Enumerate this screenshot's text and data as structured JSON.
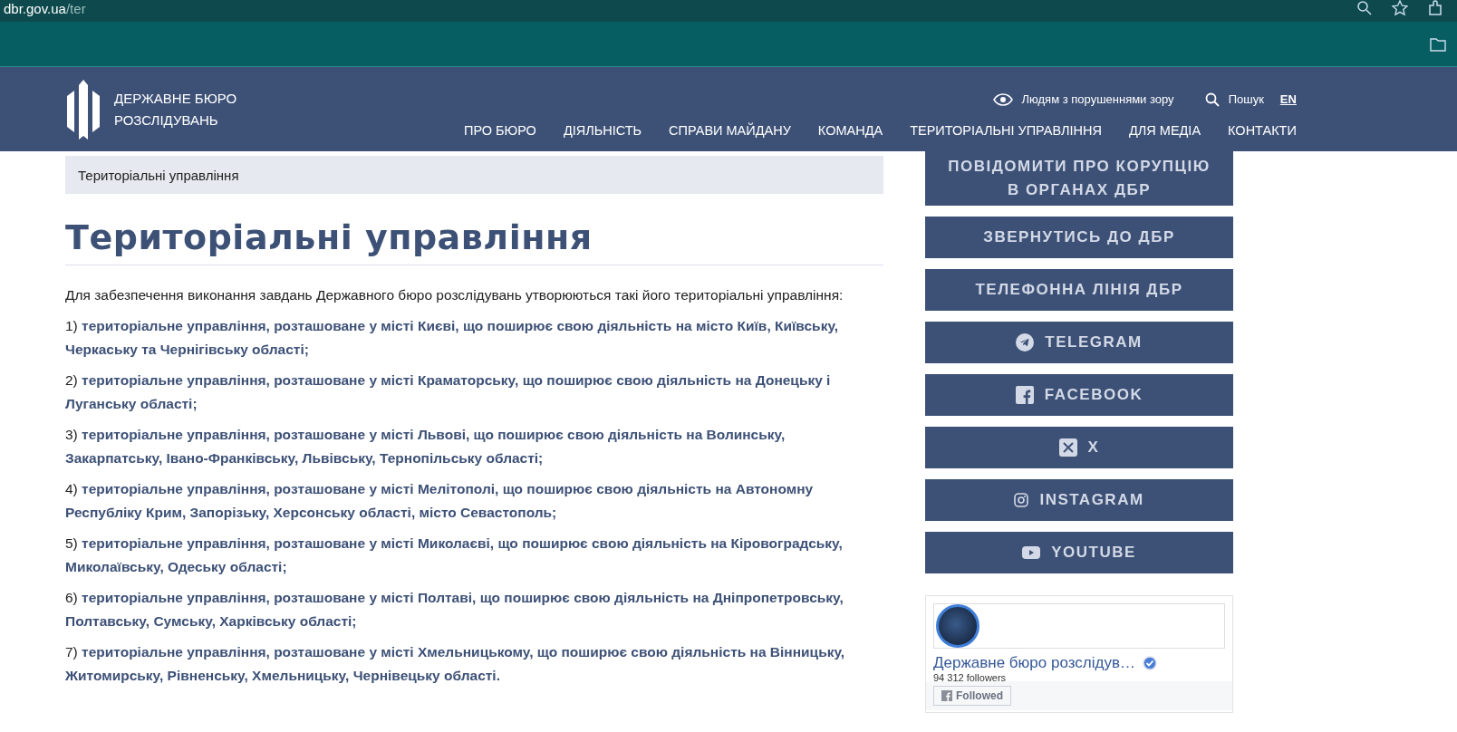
{
  "browser": {
    "url_domain": "dbr.gov.ua",
    "url_path": "/ter"
  },
  "header": {
    "logo_line_1": "ДЕРЖАВНЕ БЮРО",
    "logo_line_2": "РОЗСЛІДУВАНЬ",
    "accessibility": "Людям з порушеннями зору",
    "search": "Пошук",
    "language": "EN",
    "nav": [
      {
        "label": "ПРО БЮРО"
      },
      {
        "label": "ДІЯЛЬНІСТЬ"
      },
      {
        "label": "СПРАВИ МАЙДАНУ"
      },
      {
        "label": "КОМАНДА"
      },
      {
        "label": "ТЕРИТОРІАЛЬНІ УПРАВЛІННЯ"
      },
      {
        "label": "ДЛЯ МЕДІА"
      },
      {
        "label": "КОНТАКТИ"
      }
    ]
  },
  "breadcrumb": "Територіальні управління",
  "title": "Територіальні управління",
  "intro": "Для забезпечення виконання завдань Державного бюро розслідувань утворюються такі його територіальні управління:",
  "items": [
    {
      "text": "1) **територіальне управління, розташоване у місті Києві, що поширює свою діяльність на місто Київ, Київську, Черкаську та Чернігівську області;**"
    },
    {
      "text": "2) **територіальне управління, розташоване у місті Краматорську, що поширює свою діяльність на Донецьку і Луганську області;**"
    },
    {
      "text": "3) **територіальне управління, розташоване у місті Львові, що поширює свою діяльність на Волинську, Закарпатську, Івано-Франківську, Львівську, Тернопільську області;**"
    },
    {
      "text": "4) **територіальне управління, розташоване у місті Мелітополі, що поширює свою діяльність на Автономну Республіку Крим, Запорізьку, Херсонську області, місто Севастополь;**"
    },
    {
      "text": "5) **територіальне управління, розташоване у місті Миколаєві, що поширює свою діяльність на Кіровоградську, Миколаївську, Одеську області;**"
    },
    {
      "text": "6) **територіальне управління, розташоване у місті Полтаві, що поширює свою діяльність на Дніпропетровську, Полтавську, Сумську, Харківську області;**"
    },
    {
      "text": "7) **територіальне управління, розташоване у місті Хмельницькому, що поширює свою діяльність на Вінницьку, Житомирську, Рівненську, Хмельницьку, Чернівецьку області.**"
    }
  ],
  "sidebar_buttons": [
    {
      "kind": "text",
      "label": "ПОВІДОМИТИ ПРО КОРУПЦІЮ В ОРГАНАХ ДБР"
    },
    {
      "kind": "text",
      "label": "ЗВЕРНУТИСЬ ДО ДБР"
    },
    {
      "kind": "text",
      "label": "ТЕЛЕФОННА ЛІНІЯ ДБР"
    },
    {
      "kind": "telegram",
      "label": "TELEGRAM"
    },
    {
      "kind": "facebook",
      "label": "FACEBOOK"
    },
    {
      "kind": "x",
      "label": "X"
    },
    {
      "kind": "instagram",
      "label": "INSTAGRAM"
    },
    {
      "kind": "youtube",
      "label": "YOUTUBE"
    }
  ],
  "facebook_widget": {
    "page_name": "Державне бюро розслідув…",
    "followers": "94 312 followers",
    "button": "Followed"
  }
}
